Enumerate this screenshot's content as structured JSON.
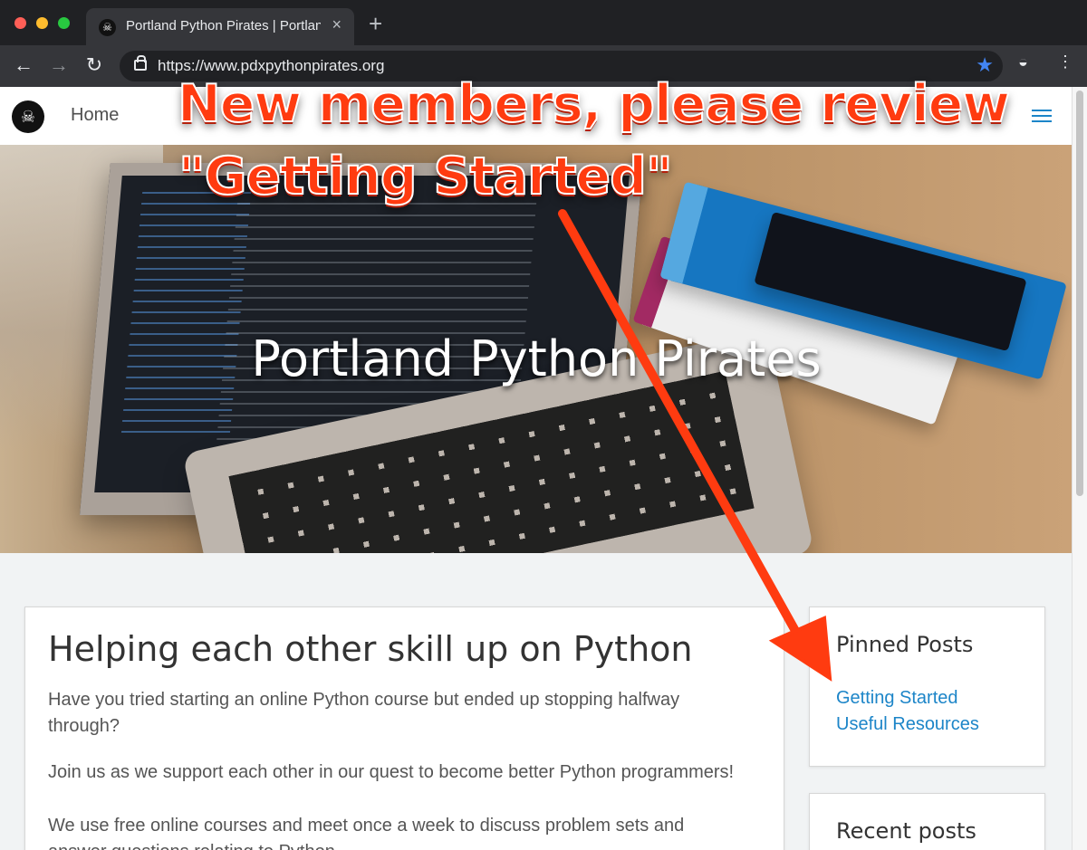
{
  "browser": {
    "tab_title": "Portland Python Pirates | Portland",
    "url": "https://www.pdxpythonpirates.org"
  },
  "site": {
    "nav_home": "Home",
    "hero_title": "Portland Python Pirates"
  },
  "content": {
    "headline": "Helping each other skill up on Python",
    "paragraph_1": "Have you tried starting an online Python course but ended up stopping halfway through?",
    "paragraph_2": "Join us as we support each other in our quest to become better Python programmers!",
    "paragraph_3": "We use free online courses and meet once a week to discuss problem sets and answer questions relating to Python."
  },
  "sidebar": {
    "pinned_title": "Pinned Posts",
    "pinned_links": [
      "Getting Started",
      "Useful Resources"
    ],
    "recent_title": "Recent posts"
  },
  "annotation": {
    "line_1": "New members, please review",
    "line_2": "\"Getting Started\""
  },
  "colors": {
    "annotation": "#ff3b10",
    "link": "#1c85c8",
    "chrome": "#202124"
  }
}
